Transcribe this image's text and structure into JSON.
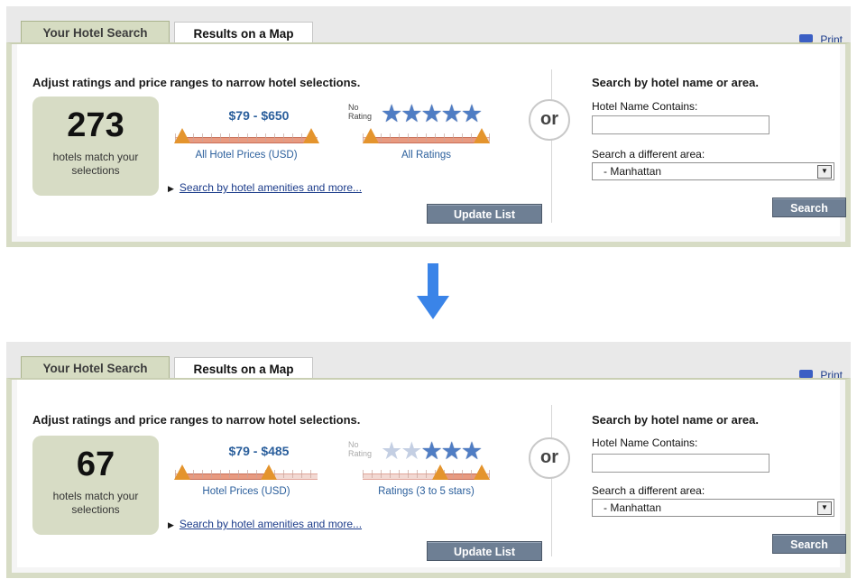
{
  "tabs": {
    "active": "Your Hotel Search",
    "map": "Results on a Map"
  },
  "print": {
    "label": "Print",
    "icon": "printer-icon"
  },
  "before": {
    "heading": "Adjust ratings and price ranges to narrow hotel selections.",
    "count": "273",
    "count_label": "hotels match your selections",
    "price_range": "$79 - $650",
    "price_label": "All Hotel Prices (USD)",
    "rating_label": "All Ratings",
    "no_rating": "No Rating",
    "stars_active": 5,
    "amenities_link": "Search by hotel amenities and more...",
    "update_button": "Update List",
    "or": "or",
    "search_heading": "Search by hotel name or area.",
    "name_label": "Hotel Name Contains:",
    "name_value": "",
    "area_label": "Search a different area:",
    "area_value": "- Manhattan",
    "search_button": "Search"
  },
  "after": {
    "heading": "Adjust ratings and price ranges to narrow hotel selections.",
    "count": "67",
    "count_label": "hotels match your selections",
    "price_range": "$79 - $485",
    "price_label": "Hotel Prices (USD)",
    "rating_label": "Ratings (3 to 5 stars)",
    "no_rating": "No Rating",
    "stars_active": 3,
    "amenities_link": "Search by hotel amenities and more...",
    "update_button": "Update List",
    "or": "or",
    "search_heading": "Search by hotel name or area.",
    "name_label": "Hotel Name Contains:",
    "name_value": "",
    "area_label": "Search a different area:",
    "area_value": "- Manhattan",
    "search_button": "Search"
  },
  "colors": {
    "accent": "#2b5f9c",
    "panel": "#d7dcc5",
    "button": "#6e7f94",
    "arrow": "#3a84e8"
  }
}
